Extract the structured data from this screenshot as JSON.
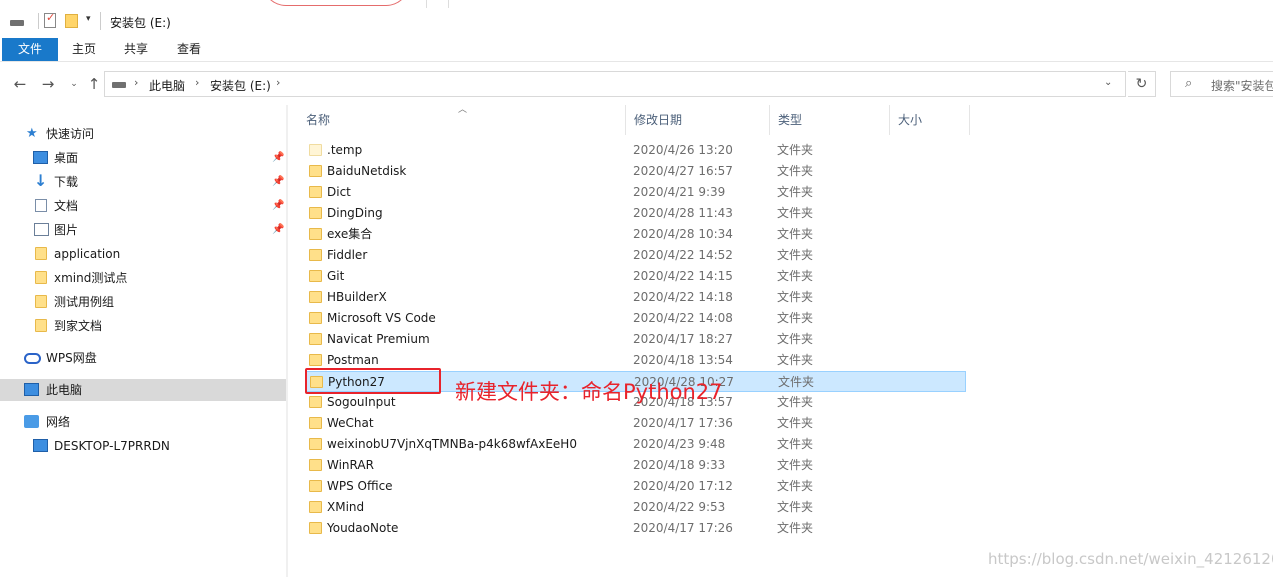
{
  "window": {
    "title": "安装包 (E:)"
  },
  "ribbon": {
    "tabs": [
      "文件",
      "主页",
      "共享",
      "查看"
    ]
  },
  "address": {
    "crumbs": [
      "此电脑",
      "安装包 (E:)"
    ],
    "search_placeholder": "搜索\"安装包"
  },
  "sidebar": {
    "items": [
      {
        "label": "快速访问",
        "icon": "star-icon"
      },
      {
        "label": "桌面",
        "icon": "desktop-icon",
        "pinned": true
      },
      {
        "label": "下载",
        "icon": "download-icon",
        "pinned": true
      },
      {
        "label": "文档",
        "icon": "documents-icon",
        "pinned": true
      },
      {
        "label": "图片",
        "icon": "pictures-icon",
        "pinned": true
      },
      {
        "label": "application",
        "icon": "folder-icon"
      },
      {
        "label": "xmind测试点",
        "icon": "folder-icon"
      },
      {
        "label": "测试用例组",
        "icon": "folder-icon"
      },
      {
        "label": "到家文档",
        "icon": "folder-icon"
      },
      {
        "label": "WPS网盘",
        "icon": "cloud-icon"
      },
      {
        "label": "此电脑",
        "icon": "computer-icon",
        "selected": true
      },
      {
        "label": "网络",
        "icon": "network-icon"
      },
      {
        "label": "DESKTOP-L7PRRDN",
        "icon": "computer-icon"
      }
    ]
  },
  "columns": {
    "name": "名称",
    "date": "修改日期",
    "type": "类型",
    "size": "大小"
  },
  "files": [
    {
      "name": ".temp",
      "date": "2020/4/26 13:20",
      "type": "文件夹"
    },
    {
      "name": "BaiduNetdisk",
      "date": "2020/4/27 16:57",
      "type": "文件夹"
    },
    {
      "name": "Dict",
      "date": "2020/4/21 9:39",
      "type": "文件夹"
    },
    {
      "name": "DingDing",
      "date": "2020/4/28 11:43",
      "type": "文件夹"
    },
    {
      "name": "exe集合",
      "date": "2020/4/28 10:34",
      "type": "文件夹"
    },
    {
      "name": "Fiddler",
      "date": "2020/4/22 14:52",
      "type": "文件夹"
    },
    {
      "name": "Git",
      "date": "2020/4/22 14:15",
      "type": "文件夹"
    },
    {
      "name": "HBuilderX",
      "date": "2020/4/22 14:18",
      "type": "文件夹"
    },
    {
      "name": "Microsoft VS Code",
      "date": "2020/4/22 14:08",
      "type": "文件夹"
    },
    {
      "name": "Navicat Premium",
      "date": "2020/4/17 18:27",
      "type": "文件夹"
    },
    {
      "name": "Postman",
      "date": "2020/4/18 13:54",
      "type": "文件夹"
    },
    {
      "name": "Python27",
      "date": "2020/4/28 10:27",
      "type": "文件夹",
      "selected": true
    },
    {
      "name": "SogouInput",
      "date": "2020/4/18 13:57",
      "type": "文件夹"
    },
    {
      "name": "WeChat",
      "date": "2020/4/17 17:36",
      "type": "文件夹"
    },
    {
      "name": "weixinobU7VjnXqTMNBa-p4k68wfAxEeH0",
      "date": "2020/4/23 9:48",
      "type": "文件夹"
    },
    {
      "name": "WinRAR",
      "date": "2020/4/18 9:33",
      "type": "文件夹"
    },
    {
      "name": "WPS Office",
      "date": "2020/4/20 17:12",
      "type": "文件夹"
    },
    {
      "name": "XMind",
      "date": "2020/4/22 9:53",
      "type": "文件夹"
    },
    {
      "name": "YoudaoNote",
      "date": "2020/4/17 17:26",
      "type": "文件夹"
    }
  ],
  "annotation": {
    "text": "新建文件夹：命名Python27"
  },
  "watermark": "https://blog.csdn.net/weixin_42126120"
}
